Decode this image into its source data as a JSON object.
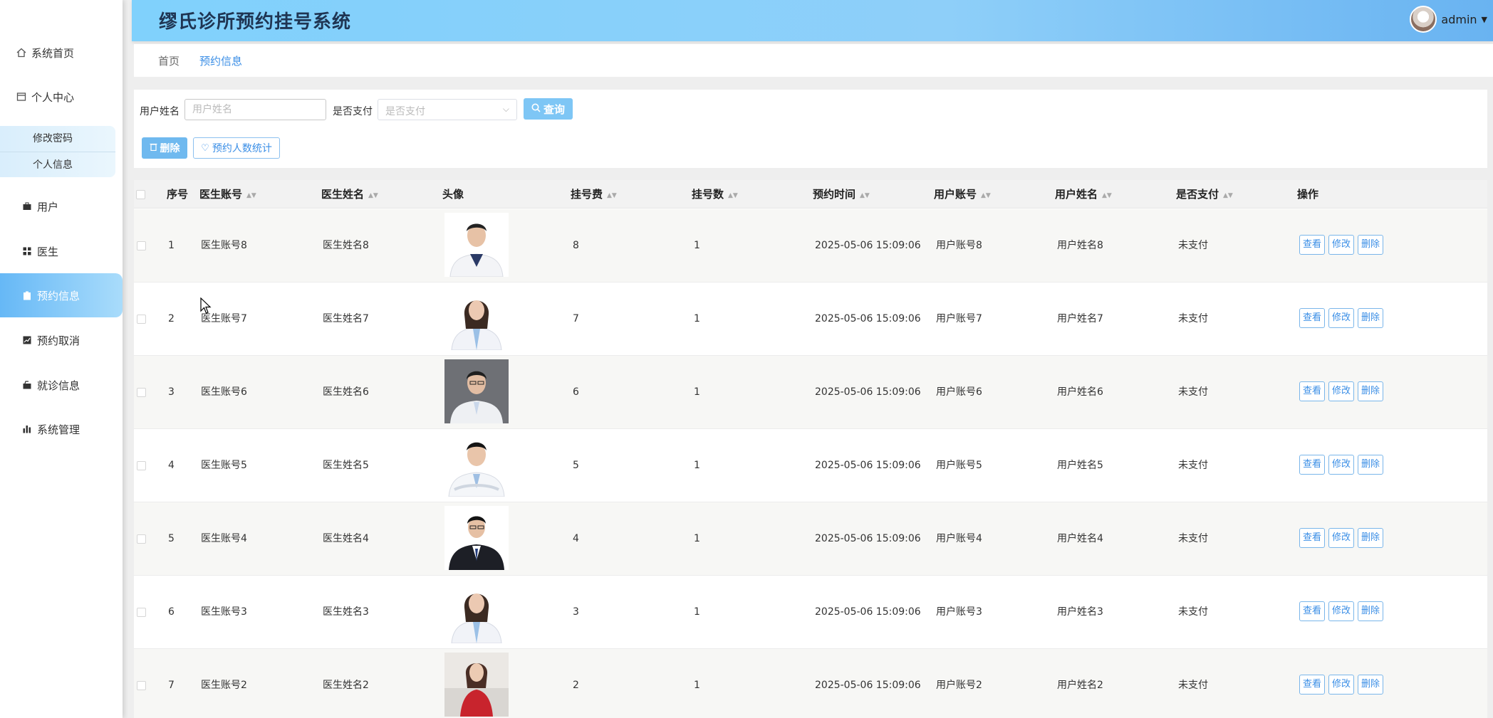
{
  "app": {
    "title": "缪氏诊所预约挂号系统",
    "username": "admin"
  },
  "sidebar": {
    "home": "系统首页",
    "personal_center": "个人中心",
    "sub_items": [
      "修改密码",
      "个人信息"
    ],
    "items": [
      {
        "label": "用户",
        "icon": "briefcase-icon"
      },
      {
        "label": "医生",
        "icon": "grid-icon"
      },
      {
        "label": "预约信息",
        "icon": "clipboard-icon"
      },
      {
        "label": "预约取消",
        "icon": "chart-icon"
      },
      {
        "label": "就诊信息",
        "icon": "case-icon"
      },
      {
        "label": "系统管理",
        "icon": "bar-chart-icon"
      }
    ]
  },
  "breadcrumb": [
    "首页",
    "预约信息"
  ],
  "search": {
    "name_label": "用户姓名",
    "name_placeholder": "用户姓名",
    "paid_label": "是否支付",
    "paid_placeholder": "是否支付",
    "query_button": "查询",
    "delete_button": "删除",
    "stats_button": "预约人数统计"
  },
  "table": {
    "columns": [
      "序号",
      "医生账号",
      "医生姓名",
      "头像",
      "挂号费",
      "挂号数",
      "预约时间",
      "用户账号",
      "用户姓名",
      "是否支付",
      "操作"
    ],
    "actions": [
      "查看",
      "修改",
      "删除"
    ],
    "rows": [
      {
        "no": "1",
        "doctor_account": "医生账号8",
        "doctor_name": "医生姓名8",
        "fee": "8",
        "count": "1",
        "time": "2025-05-06 15:09:06",
        "user_account": "用户账号8",
        "user_name": "用户姓名8",
        "paid": "未支付"
      },
      {
        "no": "2",
        "doctor_account": "医生账号7",
        "doctor_name": "医生姓名7",
        "fee": "7",
        "count": "1",
        "time": "2025-05-06 15:09:06",
        "user_account": "用户账号7",
        "user_name": "用户姓名7",
        "paid": "未支付"
      },
      {
        "no": "3",
        "doctor_account": "医生账号6",
        "doctor_name": "医生姓名6",
        "fee": "6",
        "count": "1",
        "time": "2025-05-06 15:09:06",
        "user_account": "用户账号6",
        "user_name": "用户姓名6",
        "paid": "未支付"
      },
      {
        "no": "4",
        "doctor_account": "医生账号5",
        "doctor_name": "医生姓名5",
        "fee": "5",
        "count": "1",
        "time": "2025-05-06 15:09:06",
        "user_account": "用户账号5",
        "user_name": "用户姓名5",
        "paid": "未支付"
      },
      {
        "no": "5",
        "doctor_account": "医生账号4",
        "doctor_name": "医生姓名4",
        "fee": "4",
        "count": "1",
        "time": "2025-05-06 15:09:06",
        "user_account": "用户账号4",
        "user_name": "用户姓名4",
        "paid": "未支付"
      },
      {
        "no": "6",
        "doctor_account": "医生账号3",
        "doctor_name": "医生姓名3",
        "fee": "3",
        "count": "1",
        "time": "2025-05-06 15:09:06",
        "user_account": "用户账号3",
        "user_name": "用户姓名3",
        "paid": "未支付"
      },
      {
        "no": "7",
        "doctor_account": "医生账号2",
        "doctor_name": "医生姓名2",
        "fee": "2",
        "count": "1",
        "time": "2025-05-06 15:09:06",
        "user_account": "用户账号2",
        "user_name": "用户姓名2",
        "paid": "未支付"
      }
    ]
  },
  "colors": {
    "header_start": "#80d1fc",
    "header_end": "#69b3f1",
    "accent": "#3a8ee6",
    "active_menu": "#66b8f6"
  }
}
